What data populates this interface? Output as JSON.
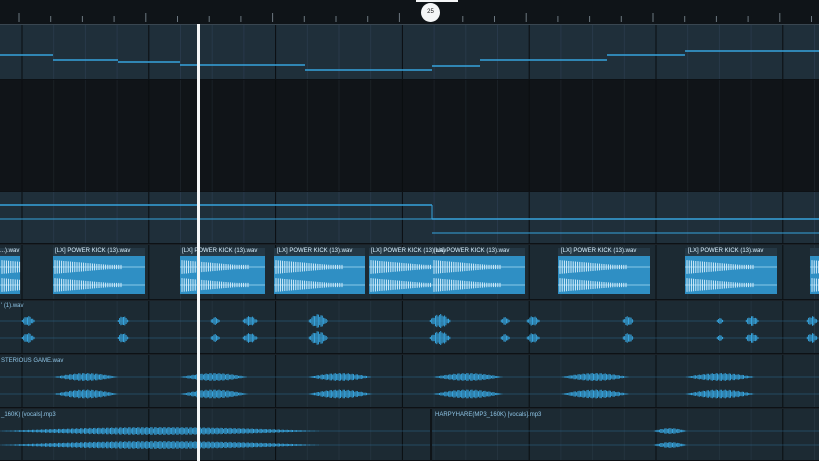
{
  "colors": {
    "background": "#1a2127",
    "ruler": "#0f1418",
    "automation_lane": "#1f2f3a",
    "grid_lane": "#101418",
    "audio_lane": "#1c2a33",
    "accent": "#36a3dc",
    "playhead": "#f4f6f7"
  },
  "ruler": {
    "marker_label": "25"
  },
  "tracks": {
    "kick": {
      "clip_labels": [
        "...).wav",
        "[LX] POWER KICK (13).wav",
        "[LX] POWER KICK (13).wav",
        "[LX] POWER KICK (13).wav",
        "[LX] POWER KICK (13).wav",
        "[LX] POWER KICK (13).wav",
        "[LX] POWER KICK (13).wav",
        "[LX] POWER KICK (13).wav"
      ]
    },
    "perc": {
      "label": "' (1).wav"
    },
    "game": {
      "label": "STERIOUS GAME.wav"
    },
    "vocals": {
      "labels": [
        "_160K) [vocals].mp3",
        "HARPYHARE(MP3_160K) [vocals].mp3"
      ]
    }
  },
  "icons": {
    "playhead": "playhead-line",
    "marker": "position-marker"
  }
}
